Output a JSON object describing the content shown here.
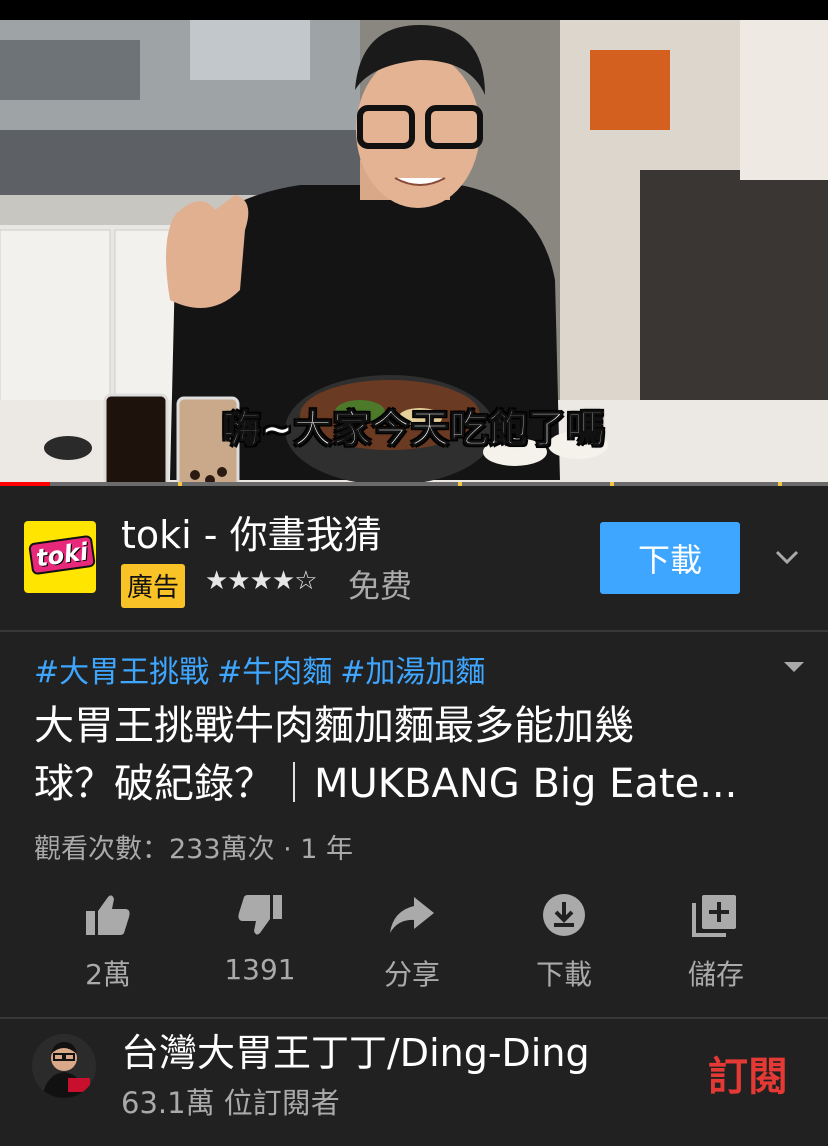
{
  "video": {
    "caption": "嗨~大家今天吃飽了嗎",
    "progress_fraction": 0.06
  },
  "ad": {
    "logo_text": "toki",
    "title": "toki - 你畫我猜",
    "badge": "廣告",
    "rating_stars": "★★★★☆",
    "price": "免费",
    "download_label": "下載",
    "chevron_icon": "chevron-down-icon"
  },
  "video_info": {
    "hashtags": [
      "#大胃王挑戰",
      "#牛肉麵",
      "#加湯加麵"
    ],
    "title_line1": "大胃王挑戰牛肉麵加麵最多能加幾",
    "title_line2": "球？破紀錄？｜MUKBANG Big Eate...",
    "views": "觀看次數：233萬次 · 1 年"
  },
  "actions": [
    {
      "icon": "thumbs-up-icon",
      "label": "2萬"
    },
    {
      "icon": "thumbs-down-icon",
      "label": "1391"
    },
    {
      "icon": "share-icon",
      "label": "分享"
    },
    {
      "icon": "download-icon",
      "label": "下載"
    },
    {
      "icon": "save-to-playlist-icon",
      "label": "儲存"
    }
  ],
  "channel": {
    "name": "台灣大胃王丁丁/Ding-Ding",
    "subscribers": "63.1萬 位訂閱者",
    "subscribe_label": "訂閱"
  },
  "colors": {
    "background": "#212121",
    "link_blue": "#3ea6ff",
    "ad_badge": "#f9c226",
    "subscribe_red": "#e53935",
    "progress_red": "#ff0000"
  }
}
